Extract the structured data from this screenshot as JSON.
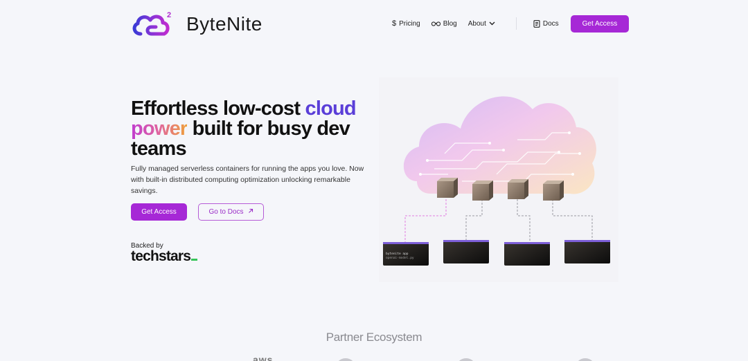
{
  "brand": {
    "name": "ByteNite"
  },
  "nav": {
    "pricing": "Pricing",
    "blog": "Blog",
    "about": "About",
    "docs": "Docs",
    "cta": "Get Access"
  },
  "hero": {
    "title_part1": "Effortless low-cost ",
    "title_cloud": "cloud",
    "title_power": "power",
    "title_part2": " built for busy dev teams",
    "subtitle": "Fully managed serverless containers for running the apps you love. Now with built-in distributed computing optimization unlocking remarkable savings.",
    "primary_button": "Get Access",
    "secondary_button": "Go to Docs"
  },
  "backed": {
    "label": "Backed by",
    "company": "techstars"
  },
  "illustration": {
    "terminal_line1": "bytenite app",
    "terminal_line2": "openai-model.py"
  },
  "partners": {
    "title": "Partner Ecosystem",
    "aws": "aws"
  },
  "colors": {
    "accent": "#a628d6",
    "cloud_word": "#5a3ed8",
    "techstars_underscore": "#38c45a",
    "background": "#f5f6fa"
  }
}
